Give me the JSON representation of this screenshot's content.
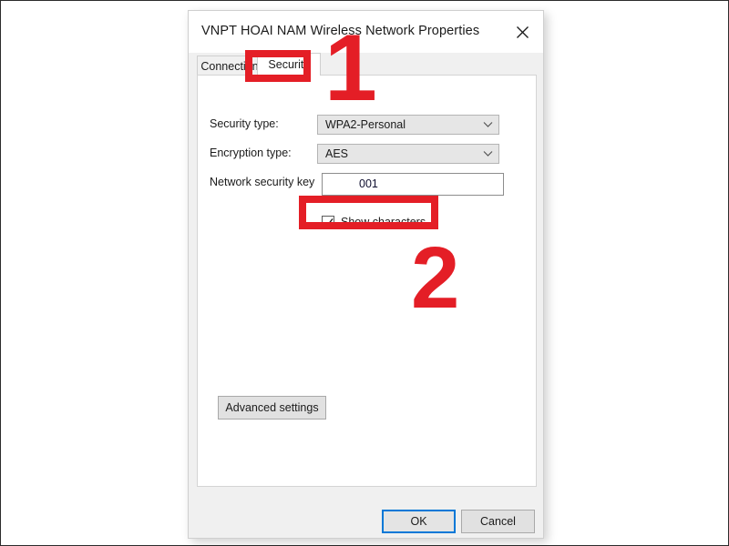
{
  "window": {
    "title": "VNPT HOAI NAM Wireless Network Properties",
    "close_icon": "close-icon"
  },
  "tabs": [
    {
      "label": "Connection",
      "active": false
    },
    {
      "label": "Security",
      "active": true
    }
  ],
  "form": {
    "security_type": {
      "label": "Security type:",
      "value": "WPA2-Personal",
      "arrow_icon": "chevron-down-icon"
    },
    "encryption_type": {
      "label": "Encryption type:",
      "value": "AES",
      "arrow_icon": "chevron-down-icon"
    },
    "network_key": {
      "label": "Network security key",
      "value": "001"
    },
    "show_characters": {
      "label": "Show characters",
      "checked": true,
      "check_icon": "checkmark-icon"
    }
  },
  "buttons": {
    "advanced_settings": "Advanced settings",
    "ok": "OK",
    "cancel": "Cancel"
  },
  "annotations": {
    "step_one": "1",
    "step_two": "2",
    "color": "#e41e26"
  }
}
